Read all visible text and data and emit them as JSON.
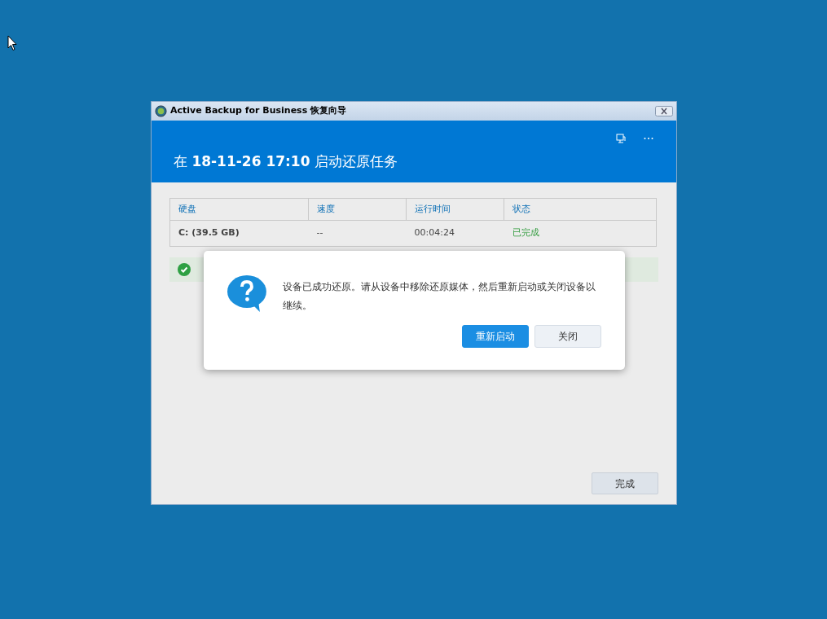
{
  "window": {
    "title": "Active Backup for Business 恢复向导"
  },
  "header": {
    "heading": "在 **18-11-26 17:10** 启动还原任务"
  },
  "table": {
    "columns": [
      "硬盘",
      "速度",
      "运行时间",
      "状态"
    ],
    "rows": [
      {
        "cells": [
          "C: (39.5 GB)",
          "--",
          "00:04:24",
          "已完成"
        ]
      }
    ]
  },
  "dialog": {
    "message": "设备已成功还原。请从设备中移除还原媒体，然后重新启动或关闭设备以继续。",
    "buttons": [
      {
        "label": "重新启动",
        "kind": "primary"
      },
      {
        "label": "关闭",
        "kind": "secondary"
      }
    ]
  },
  "footer": {
    "finish_button": "完成"
  }
}
